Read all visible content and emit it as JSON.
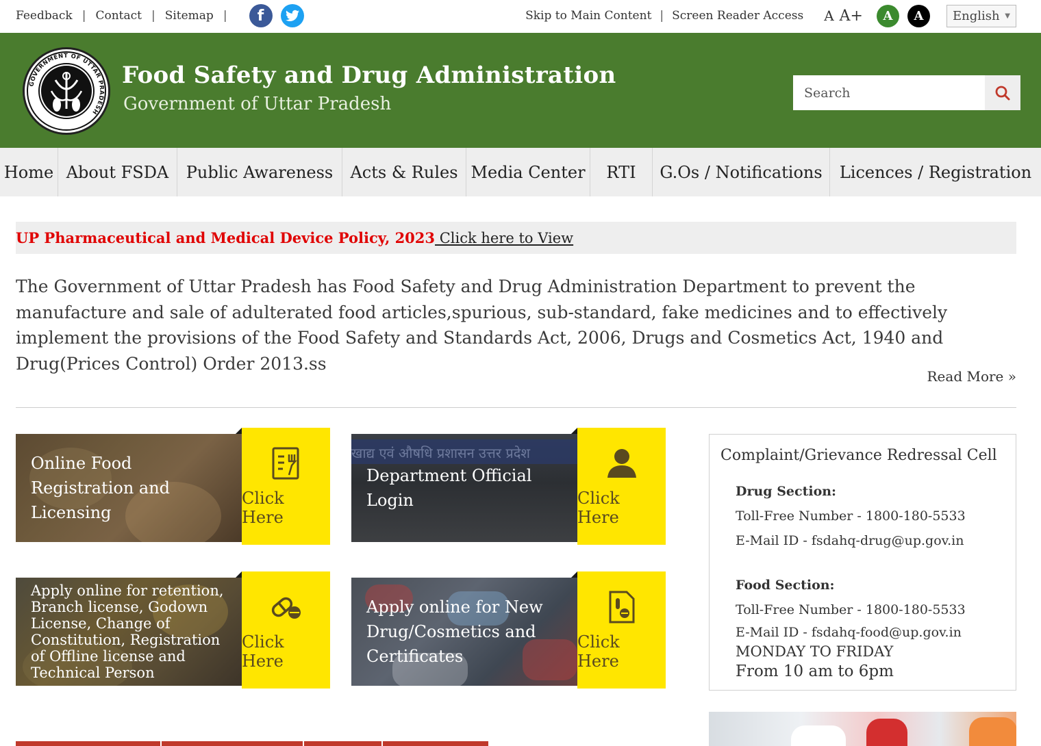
{
  "topbar": {
    "links": [
      "Feedback",
      "Contact",
      "Sitemap"
    ],
    "social": [
      "facebook-icon",
      "twitter-icon"
    ],
    "skip_link": "Skip to Main Content",
    "screen_reader": "Screen Reader Access",
    "font_normal": "A",
    "font_larger": "A+",
    "contrast_green": "A",
    "contrast_black": "A",
    "language": "English"
  },
  "header": {
    "title": "Food Safety and Drug Administration",
    "subtitle": "Government of Uttar Pradesh",
    "emblem_text": "GOVERNMENT OF UTTAR PRADESH",
    "search_placeholder": "Search"
  },
  "nav": {
    "items": [
      "Home",
      "About FSDA",
      "Public Awareness",
      "Acts & Rules",
      "Media Center",
      "RTI",
      "G.Os / Notifications",
      "Licences / Registration"
    ]
  },
  "policy": {
    "title": "UP Pharmaceutical and Medical Device Policy, 2023",
    "link": " Click here to View"
  },
  "intro": {
    "text": "The Government of Uttar Pradesh has Food Safety and Drug Administration Department to prevent the manufacture and sale of adulterated food articles,spurious, sub-standard, fake medicines and to effectively implement the provisions of the Food Safety and Standards Act, 2006, Drugs and Cosmetics Act, 1940 and Drug(Prices Control) Order 2013.ss",
    "read_more": "Read More »"
  },
  "tiles": [
    {
      "text": "Online Food Registration and Licensing",
      "button": "Click Here",
      "icon": "document-fork-icon"
    },
    {
      "text": "Department Official Login",
      "button": "Click Here",
      "icon": "user-icon",
      "bg_text": "खाद्य एवं औषधि प्रशासन उत्तर प्रदेश"
    },
    {
      "text": "Apply online for retention, Branch license, Godown License, Change of Constitution, Registration of Offline license and Technical Person",
      "button": "Click Here",
      "icon": "pill-icon"
    },
    {
      "text": "Apply online for New Drug/Cosmetics and Certificates",
      "button": "Click Here",
      "icon": "drug-document-icon"
    }
  ],
  "complaint": {
    "heading": "Complaint/Grievance Redressal Cell",
    "drug": {
      "label": "Drug Section:",
      "phone": "Toll-Free Number - 1800-180-5533",
      "email": "E-Mail ID - fsdahq-drug@up.gov.in"
    },
    "food": {
      "label": "Food Section:",
      "phone": "Toll-Free Number - 1800-180-5533",
      "email": "E-Mail ID - fsdahq-food@up.gov.in",
      "days": "MONDAY TO FRIDAY",
      "hours": "From 10 am to 6pm"
    }
  },
  "colors": {
    "header_green": "#4a7c2e",
    "tile_yellow": "#ffe600",
    "policy_red": "#e00000",
    "bottom_tab_red": "#c0392b"
  }
}
